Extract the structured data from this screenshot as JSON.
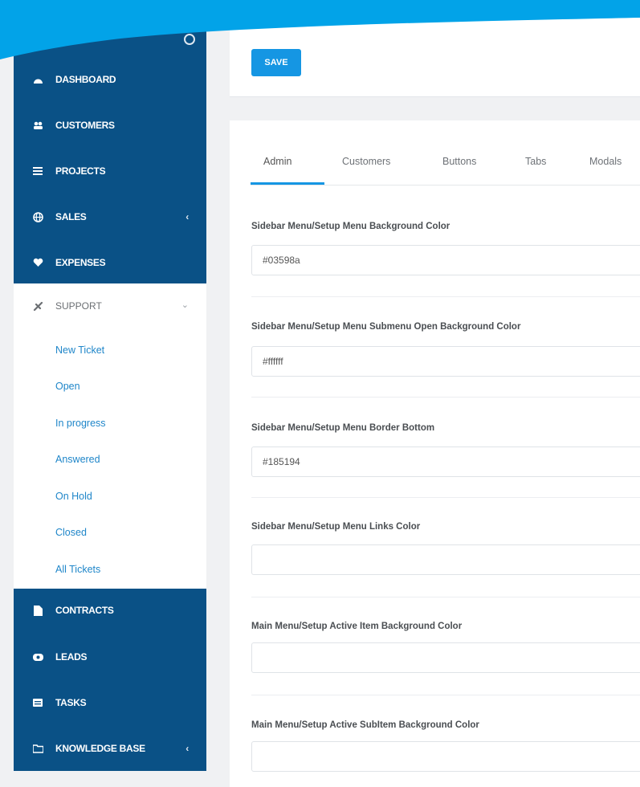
{
  "sidebar": {
    "items": [
      {
        "label": "DASHBOARD",
        "icon": "dashboard-icon"
      },
      {
        "label": "CUSTOMERS",
        "icon": "users-icon"
      },
      {
        "label": "PROJECTS",
        "icon": "list-icon"
      },
      {
        "label": "SALES",
        "icon": "globe-icon",
        "caret": "‹"
      },
      {
        "label": "EXPENSES",
        "icon": "heart-icon"
      }
    ],
    "support": {
      "label": "SUPPORT",
      "icon": "ticket-icon",
      "caret": "⌄"
    },
    "support_links": [
      "New Ticket",
      "Open",
      "In progress",
      "Answered",
      "On Hold",
      "Closed",
      "All Tickets"
    ],
    "items_after": [
      {
        "label": "CONTRACTS",
        "icon": "file-icon"
      },
      {
        "label": "LEADS",
        "icon": "tty-icon"
      },
      {
        "label": "TASKS",
        "icon": "tasks-icon"
      },
      {
        "label": "KNOWLEDGE BASE",
        "icon": "folder-icon",
        "caret": "‹"
      }
    ]
  },
  "toolbar": {
    "save_label": "SAVE"
  },
  "tabs": [
    "Admin",
    "Customers",
    "Buttons",
    "Tabs",
    "Modals"
  ],
  "active_tab": "Admin",
  "fields": [
    {
      "label": "Sidebar Menu/Setup Menu Background Color",
      "value": "#03598a"
    },
    {
      "label": "Sidebar Menu/Setup Menu Submenu Open Background Color",
      "value": "#ffffff"
    },
    {
      "label": "Sidebar Menu/Setup Menu Border Bottom",
      "value": "#185194"
    },
    {
      "label": "Sidebar Menu/Setup Menu Links Color",
      "value": ""
    },
    {
      "label": "Main Menu/Setup Active Item Background Color",
      "value": ""
    },
    {
      "label": "Main Menu/Setup Active SubItem Background Color",
      "value": ""
    }
  ],
  "colors": {
    "sidebar_bg": "#0a5186",
    "accent": "#1596e3",
    "link": "#1f86c9",
    "swoosh": "#02a3e8"
  }
}
